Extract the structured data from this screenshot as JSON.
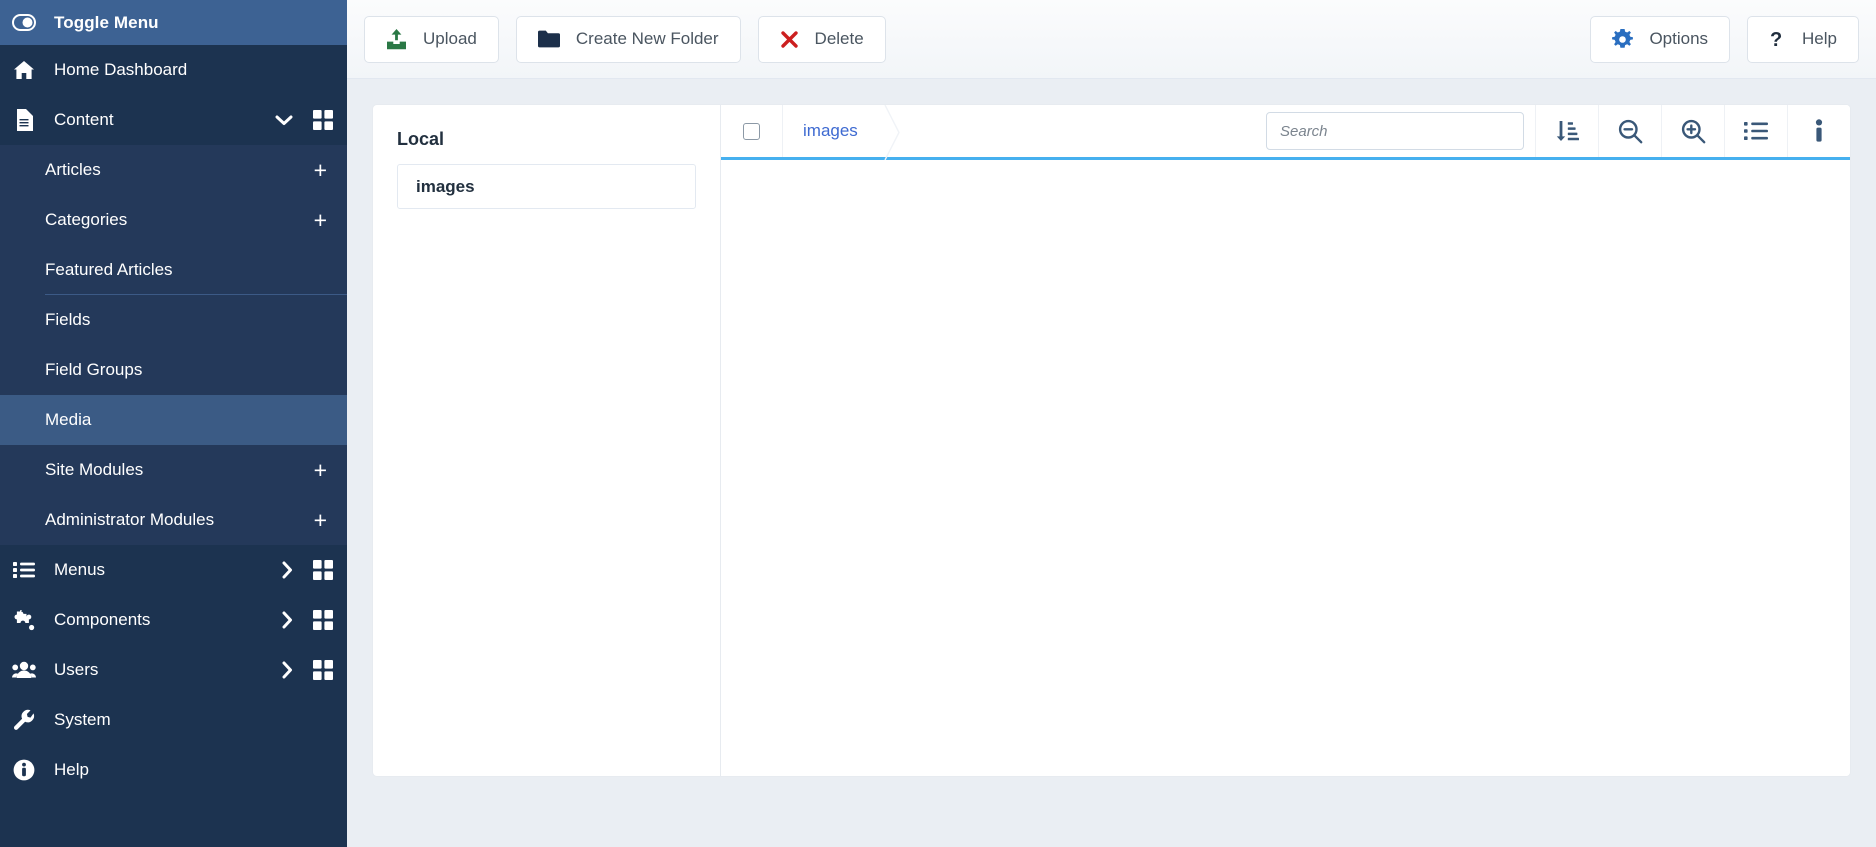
{
  "sidebar": {
    "toggle": {
      "label": "Toggle Menu",
      "icon": "toggle-switch-icon"
    },
    "items": [
      {
        "label": "Home Dashboard",
        "icon": "home-icon",
        "has_chevron": false,
        "has_grid": false
      },
      {
        "label": "Content",
        "icon": "document-icon",
        "has_chevron": true,
        "chevron": "down",
        "has_grid": true
      }
    ],
    "content_subitems": [
      {
        "label": "Articles",
        "action": "+",
        "separator": false
      },
      {
        "label": "Categories",
        "action": "+",
        "separator": false
      },
      {
        "label": "Featured Articles",
        "action": "",
        "separator": true
      },
      {
        "label": "Fields",
        "action": "",
        "separator": false
      },
      {
        "label": "Field Groups",
        "action": "",
        "separator": false
      },
      {
        "label": "Media",
        "action": "",
        "separator": false,
        "active": true
      },
      {
        "label": "Site Modules",
        "action": "+",
        "separator": false
      },
      {
        "label": "Administrator Modules",
        "action": "+",
        "separator": false
      }
    ],
    "items_after": [
      {
        "label": "Menus",
        "icon": "list-icon",
        "has_chevron": true,
        "chevron": "right",
        "has_grid": true
      },
      {
        "label": "Components",
        "icon": "puzzle-icon",
        "has_chevron": true,
        "chevron": "right",
        "has_grid": true
      },
      {
        "label": "Users",
        "icon": "users-icon",
        "has_chevron": true,
        "chevron": "right",
        "has_grid": true
      },
      {
        "label": "System",
        "icon": "wrench-icon",
        "has_chevron": false,
        "has_grid": false
      },
      {
        "label": "Help",
        "icon": "info-circle-icon",
        "has_chevron": false,
        "has_grid": false
      }
    ],
    "colors": {
      "background": "#1c3350",
      "toggle_bar": "#3d6293",
      "submenu": "#24395a",
      "active": "#3b5b85"
    }
  },
  "toolbar": {
    "upload_label": "Upload",
    "create_folder_label": "Create New Folder",
    "delete_label": "Delete",
    "options_label": "Options",
    "help_label": "Help",
    "icons": {
      "upload": "upload-icon",
      "folder": "folder-icon",
      "delete": "x-mark-icon",
      "options": "gear-icon",
      "help": "question-mark-icon"
    },
    "colors": {
      "upload_icon": "#2a7845",
      "folder_icon": "#1c2f4a",
      "delete_icon": "#cc1f1f",
      "gear_icon": "#2a6ec0",
      "help_icon": "#1f2d3d"
    }
  },
  "tree": {
    "title": "Local",
    "items": [
      {
        "label": "images"
      }
    ]
  },
  "browser": {
    "breadcrumb": [
      "images"
    ],
    "search": {
      "placeholder": "Search",
      "value": ""
    },
    "actions": [
      {
        "name": "sort-descending-icon"
      },
      {
        "name": "zoom-out-icon"
      },
      {
        "name": "zoom-in-icon"
      },
      {
        "name": "list-view-icon"
      },
      {
        "name": "info-icon"
      }
    ],
    "accent_color": "#46b0ef",
    "icon_color": "#3a5878",
    "empty": true
  }
}
